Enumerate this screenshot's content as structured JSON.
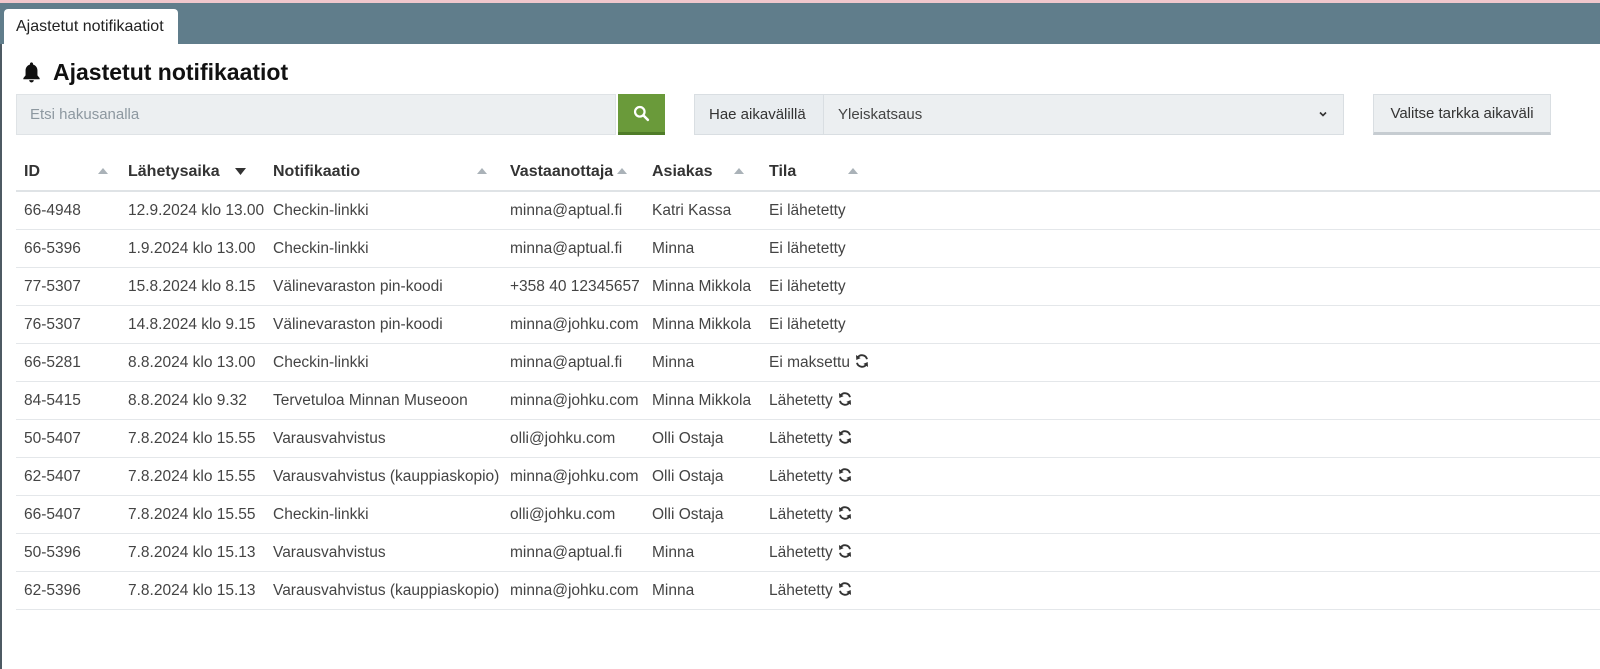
{
  "tab": {
    "label": "Ajastetut notifikaatiot"
  },
  "page": {
    "title": "Ajastetut notifikaatiot",
    "icon": "bell-icon"
  },
  "search": {
    "placeholder": "Etsi hakusanalla",
    "value": "",
    "button_icon": "search-icon"
  },
  "range": {
    "label": "Hae aikavälillä",
    "selected": "Yleiskatsaus",
    "exact_button": "Valitse tarkka aikaväli"
  },
  "colors": {
    "tabbar": "#607d8b",
    "search_button": "#6a9a3a",
    "sort_arrow": "#aab2b8"
  },
  "table": {
    "columns": [
      "ID",
      "Lähetysaika",
      "Notifikaatio",
      "Vastaanottaja",
      "Asiakas",
      "Tila"
    ],
    "active_sort": "Lähetysaika",
    "rows": [
      {
        "id": "66-4948",
        "time": "12.9.2024 klo 13.00",
        "notification": "Checkin-linkki",
        "recipient": "minna@aptual.fi",
        "customer": "Katri Kassa",
        "status": "Ei lähetetty",
        "resend": false
      },
      {
        "id": "66-5396",
        "time": "1.9.2024 klo 13.00",
        "notification": "Checkin-linkki",
        "recipient": "minna@aptual.fi",
        "customer": "Minna",
        "status": "Ei lähetetty",
        "resend": false
      },
      {
        "id": "77-5307",
        "time": "15.8.2024 klo 8.15",
        "notification": "Välinevaraston pin-koodi",
        "recipient": "+358 40 12345657",
        "customer": "Minna Mikkola",
        "status": "Ei lähetetty",
        "resend": false
      },
      {
        "id": "76-5307",
        "time": "14.8.2024 klo 9.15",
        "notification": "Välinevaraston pin-koodi",
        "recipient": "minna@johku.com",
        "customer": "Minna Mikkola",
        "status": "Ei lähetetty",
        "resend": false
      },
      {
        "id": "66-5281",
        "time": "8.8.2024 klo 13.00",
        "notification": "Checkin-linkki",
        "recipient": "minna@aptual.fi",
        "customer": "Minna",
        "status": "Ei maksettu",
        "resend": true
      },
      {
        "id": "84-5415",
        "time": "8.8.2024 klo 9.32",
        "notification": "Tervetuloa Minnan Museoon",
        "recipient": "minna@johku.com",
        "customer": "Minna Mikkola",
        "status": "Lähetetty",
        "resend": true
      },
      {
        "id": "50-5407",
        "time": "7.8.2024 klo 15.55",
        "notification": "Varausvahvistus",
        "recipient": "olli@johku.com",
        "customer": "Olli Ostaja",
        "status": "Lähetetty",
        "resend": true
      },
      {
        "id": "62-5407",
        "time": "7.8.2024 klo 15.55",
        "notification": "Varausvahvistus (kauppiaskopio)",
        "recipient": "minna@johku.com",
        "customer": "Olli Ostaja",
        "status": "Lähetetty",
        "resend": true
      },
      {
        "id": "66-5407",
        "time": "7.8.2024 klo 15.55",
        "notification": "Checkin-linkki",
        "recipient": "olli@johku.com",
        "customer": "Olli Ostaja",
        "status": "Lähetetty",
        "resend": true
      },
      {
        "id": "50-5396",
        "time": "7.8.2024 klo 15.13",
        "notification": "Varausvahvistus",
        "recipient": "minna@aptual.fi",
        "customer": "Minna",
        "status": "Lähetetty",
        "resend": true
      },
      {
        "id": "62-5396",
        "time": "7.8.2024 klo 15.13",
        "notification": "Varausvahvistus (kauppiaskopio)",
        "recipient": "minna@johku.com",
        "customer": "Minna",
        "status": "Lähetetty",
        "resend": true
      }
    ]
  }
}
